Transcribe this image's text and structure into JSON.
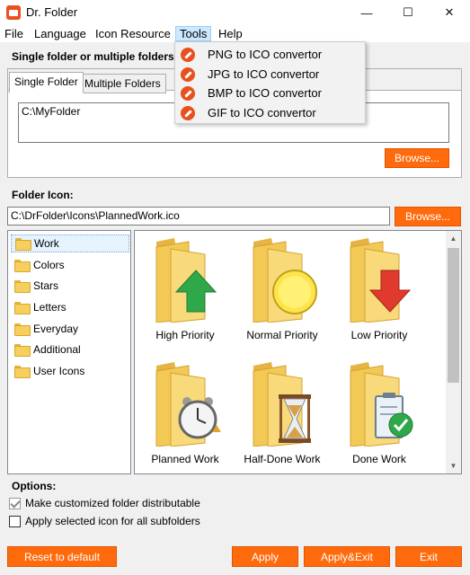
{
  "window": {
    "title": "Dr. Folder",
    "minimize": "—",
    "maximize": "☐",
    "close": "✕"
  },
  "menu": {
    "file": "File",
    "language": "Language",
    "icon_resource": "Icon Resource",
    "tools": "Tools",
    "help": "Help"
  },
  "tools_menu": {
    "items": [
      {
        "label": "PNG to ICO convertor",
        "icon": "convert-icon"
      },
      {
        "label": "JPG to ICO convertor",
        "icon": "convert-icon"
      },
      {
        "label": "BMP to ICO convertor",
        "icon": "convert-icon"
      },
      {
        "label": "GIF to ICO convertor",
        "icon": "convert-icon"
      }
    ]
  },
  "folders_section": {
    "label": "Single folder or multiple folders:",
    "tabs": [
      "Single Folder",
      "Multiple Folders"
    ],
    "path": "C:\\MyFolder",
    "browse": "Browse..."
  },
  "icon_section": {
    "label": "Folder Icon:",
    "path": "C:\\DrFolder\\Icons\\PlannedWork.ico",
    "browse": "Browse..."
  },
  "categories": [
    "Work",
    "Colors",
    "Stars",
    "Letters",
    "Everyday",
    "Additional",
    "User Icons"
  ],
  "icons": [
    {
      "label": "High Priority",
      "icon": "folder-up-arrow-icon"
    },
    {
      "label": "Normal Priority",
      "icon": "folder-yellow-circle-icon"
    },
    {
      "label": "Low Priority",
      "icon": "folder-down-arrow-icon"
    },
    {
      "label": "Planned Work",
      "icon": "folder-alarm-clock-icon"
    },
    {
      "label": "Half-Done Work",
      "icon": "folder-hourglass-icon"
    },
    {
      "label": "Done Work",
      "icon": "folder-checklist-icon"
    }
  ],
  "options": {
    "label": "Options:",
    "distributable": {
      "label": "Make customized folder distributable",
      "checked": true
    },
    "subfolders": {
      "label": "Apply selected icon for all subfolders",
      "checked": false
    }
  },
  "buttons": {
    "reset": "Reset to default",
    "apply": "Apply",
    "apply_exit": "Apply&Exit",
    "exit": "Exit"
  },
  "colors": {
    "accent": "#ff6a0d",
    "menu_highlight": "#cce8ff",
    "folder": "#f6cf5e"
  }
}
